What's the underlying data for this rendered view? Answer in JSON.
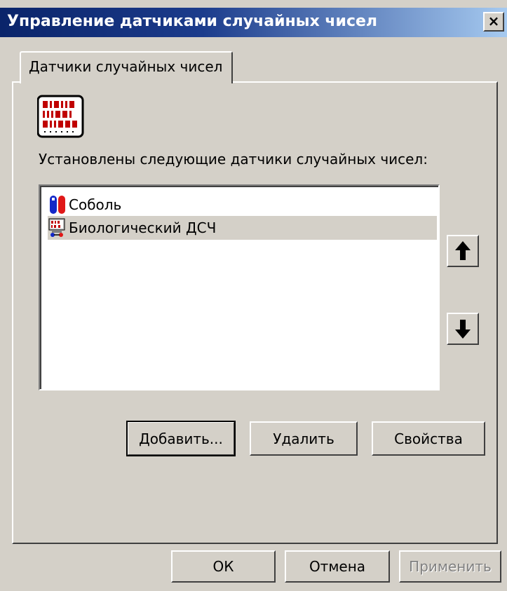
{
  "window": {
    "title": "Управление датчиками случайных чисел",
    "close_glyph": "×"
  },
  "tabs": [
    {
      "label": "Датчики случайных чисел",
      "active": true
    }
  ],
  "panel": {
    "icon": "binary-chip-icon",
    "installed_label": "Установлены следующие датчики случайных чисел:"
  },
  "generators": [
    {
      "label": "Соболь",
      "icon": "sobol-device-icon",
      "selected": false
    },
    {
      "label": "Биологический ДСЧ",
      "icon": "biological-rng-icon",
      "selected": true
    }
  ],
  "list_actions": {
    "move_up_icon": "arrow-up-icon",
    "move_down_icon": "arrow-down-icon",
    "add_label": "Добавить...",
    "remove_label": "Удалить",
    "properties_label": "Свойства"
  },
  "footer": {
    "ok_label": "ОК",
    "cancel_label": "Отмена",
    "apply_label": "Применить",
    "apply_enabled": false
  },
  "colors": {
    "titlebar_start": "#0a246a",
    "titlebar_end": "#a6caf0",
    "face": "#d4d0c8",
    "sobol_blue": "#1428c8",
    "sobol_red": "#e01818",
    "chip_red": "#c00000"
  }
}
